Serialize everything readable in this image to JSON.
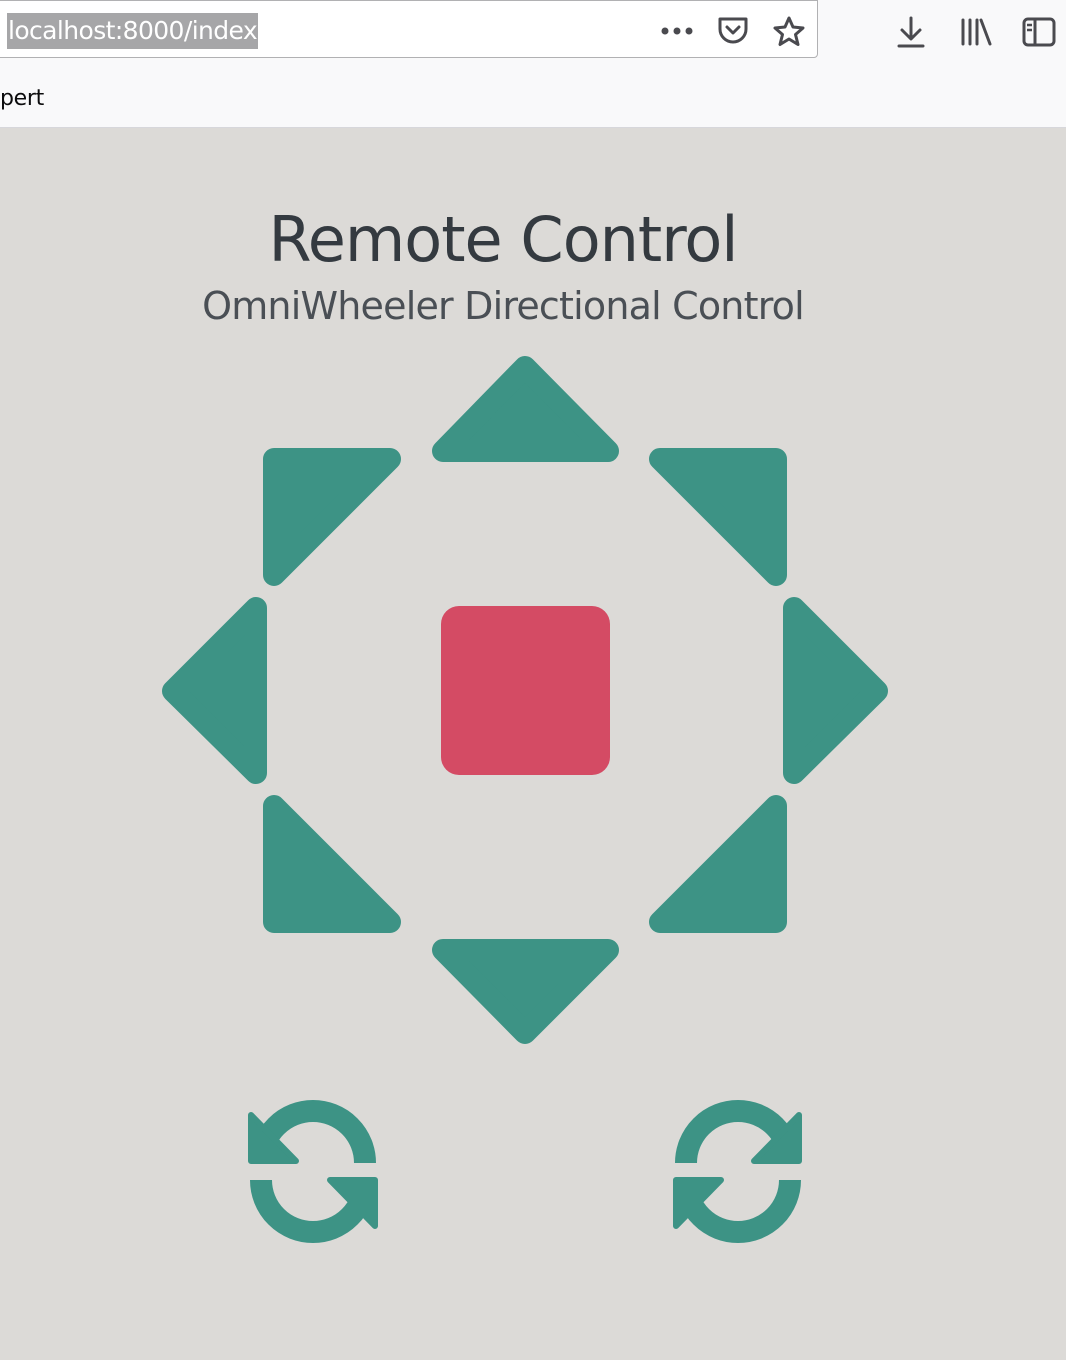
{
  "browser": {
    "url": "localhost:8000/index",
    "bookmark_label": "pert"
  },
  "page": {
    "title": "Remote Control",
    "subtitle": "OmniWheeler Directional Control"
  },
  "colors": {
    "arrow": "#3d9385",
    "stop": "#d44b64",
    "background": "#dcdad7"
  },
  "icons": {
    "page_actions": "more-icon",
    "pocket": "pocket-icon",
    "bookmark": "star-icon",
    "downloads": "download-icon",
    "library": "library-icon",
    "sidebar": "sidebar-icon"
  }
}
